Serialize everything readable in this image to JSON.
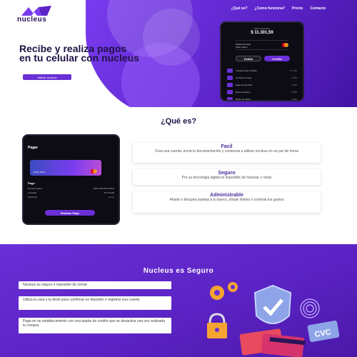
{
  "brand": {
    "name": "nucleus"
  },
  "nav": {
    "items": [
      "¿Qué es?",
      "¿Como funciona?",
      "Precio",
      "Contacto"
    ]
  },
  "hero": {
    "title": "Recibe y realiza pagos en tu celular con nucleus",
    "cta": "Utilizar nucleus"
  },
  "phone1": {
    "balance_label": "Saldo disponible",
    "balance": "$ 11.301,59",
    "card_label": "Tarjeta principal",
    "card_name": "Pedro Perez",
    "tabs": [
      "Debito",
      "Credito"
    ],
    "items": [
      {
        "label": "Transferencia recibida",
        "amount": "$ 1.200"
      },
      {
        "label": "Compra en linea",
        "amount": "$ 450"
      },
      {
        "label": "Pago de servicios",
        "amount": "$ 320"
      },
      {
        "label": "Envio de dinero",
        "amount": "$ 800"
      },
      {
        "label": "Retiro en cajero",
        "amount": "$ 500"
      }
    ]
  },
  "que_es": {
    "title": "¿Qué es?",
    "phone": {
      "header": "Pagar",
      "card_name": "Pedro Perez",
      "section": "Pago",
      "rows": [
        {
          "label": "Numero tarjeta",
          "value": "5454 4545 6874 8612"
        },
        {
          "label": "Cantidad",
          "value": "$ 5.118,95"
        },
        {
          "label": "Password",
          "value": "••••••••"
        }
      ],
      "button": "Realizar Pago"
    },
    "features": [
      {
        "title": "Facil",
        "desc": "Crea una cuenta, envia tu documentación y comienza a utilizar nucleus en un par de horas"
      },
      {
        "title": "Seguro",
        "desc": "Por su tecnologia digital es imposible de hackear o robar"
      },
      {
        "title": "Administrable",
        "desc": "Añade o bloquea tarjetas a tu banco, añade limites o controla tus gastos"
      }
    ]
  },
  "seguro": {
    "title": "Nucleus es Seguro",
    "items": [
      "Nucleus es seguro e imposible de clonar",
      "Utiliza tu cara o tu dedo para confirmar un deposito o registrar una cuenta",
      "Paga en un establecimiento con una tarjeta de credito que se desactiva una vez realizada tu compra"
    ],
    "illustration_text": "CVC"
  },
  "colors": {
    "purple": "#6a2fd6",
    "dark": "#1f1145"
  }
}
